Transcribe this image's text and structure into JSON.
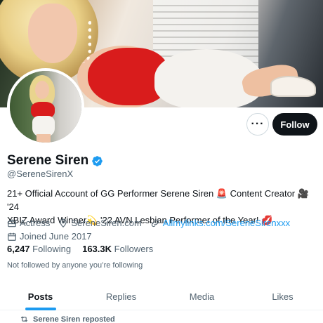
{
  "profile": {
    "name": "Serene Siren",
    "handle": "@SereneSirenX",
    "bio_line1": "21+ Official Account of GG Performer Serene Siren",
    "bio_line1_after": " Content Creator",
    "bio_line1_end": " '24",
    "bio_line2": "XBIZ Award Winner",
    "bio_line2_after": " '22 AVN Lesbian Performer of the Year!",
    "emoji_siren": "🚨",
    "emoji_camera": "🎥",
    "emoji_sparkle": "💫",
    "emoji_kiss": "💋",
    "category": "Actress",
    "location": "SereneSiren.com",
    "link": "Allmylinks.com/SereneSirenxxx",
    "joined": "Joined June 2017",
    "following_count": "6,247",
    "following_label": "Following",
    "followers_count": "163.3K",
    "followers_label": "Followers",
    "not_followed": "Not followed by anyone you’re following"
  },
  "actions": {
    "more_label": "···",
    "follow_label": "Follow"
  },
  "tabs": [
    {
      "label": "Posts",
      "active": true
    },
    {
      "label": "Replies",
      "active": false
    },
    {
      "label": "Media",
      "active": false
    },
    {
      "label": "Likes",
      "active": false
    }
  ],
  "timeline": {
    "repost_label": "Serene Siren reposted"
  },
  "colors": {
    "accent": "#1d9bf0",
    "text_primary": "#0f1419",
    "text_secondary": "#536471",
    "follow_bg": "#0f1419"
  },
  "icons": [
    "verified-badge-icon",
    "briefcase-icon",
    "location-pin-icon",
    "link-icon",
    "calendar-icon",
    "repost-icon"
  ]
}
